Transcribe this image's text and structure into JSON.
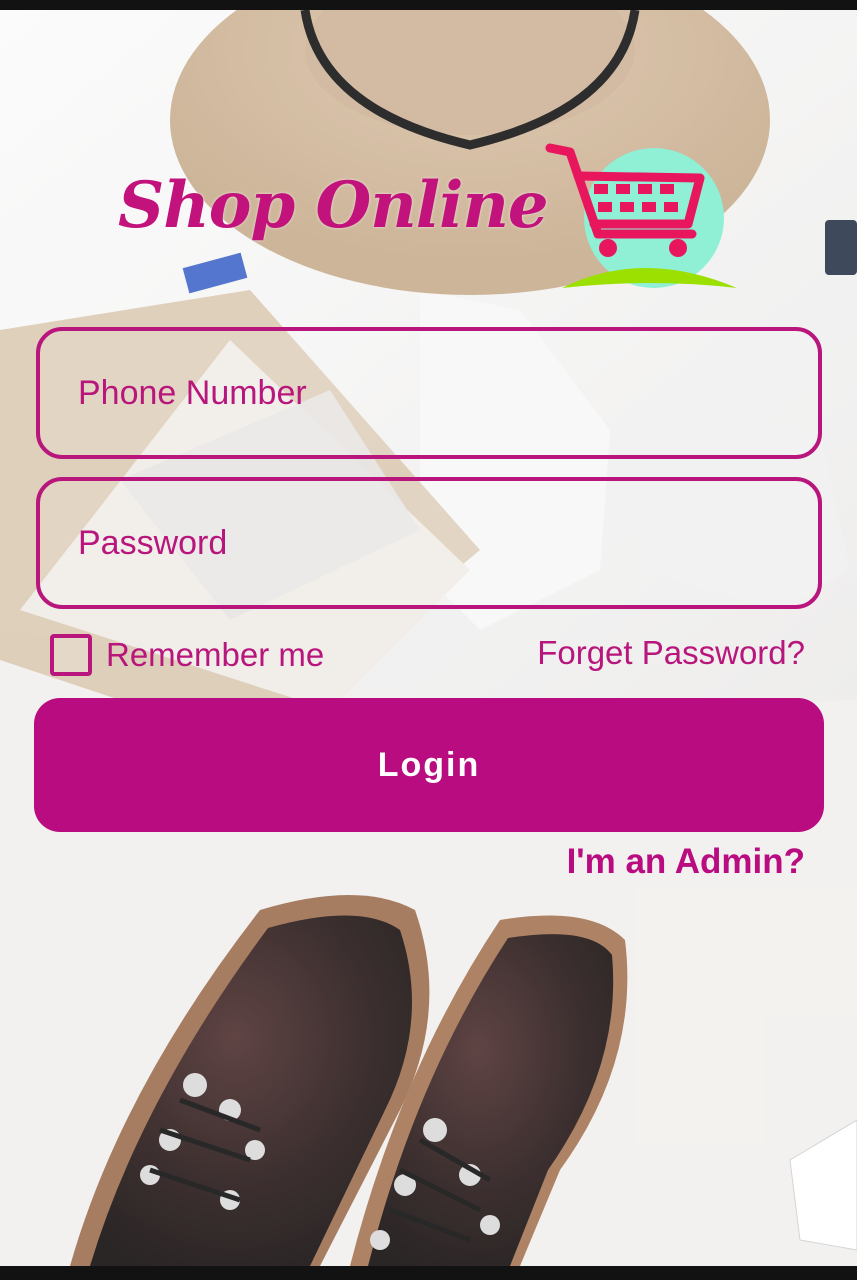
{
  "logo": {
    "text": "Shop Online",
    "icon": "shopping-cart-icon",
    "colors": {
      "text": "#c2127c",
      "cart": "#e8175d",
      "circle": "#8ff0d6",
      "swoosh": "#9be000"
    }
  },
  "form": {
    "phone": {
      "placeholder": "Phone Number",
      "value": ""
    },
    "password": {
      "placeholder": "Password",
      "value": ""
    },
    "remember_label": "Remember me",
    "remember_checked": false,
    "forgot_label": "Forget Password?",
    "login_label": "Login",
    "admin_label": "I'm an Admin?"
  },
  "theme": {
    "accent": "#b80c80",
    "button_text": "#ffffff"
  }
}
